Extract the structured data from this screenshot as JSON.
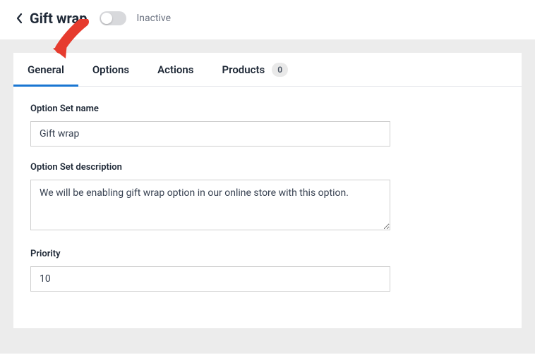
{
  "header": {
    "title": "Gift wrap",
    "status": "Inactive"
  },
  "tabs": {
    "general": "General",
    "options": "Options",
    "actions": "Actions",
    "products": "Products",
    "products_count": "0"
  },
  "form": {
    "name_label": "Option Set name",
    "name_value": "Gift wrap",
    "desc_label": "Option Set description",
    "desc_value": "We will be enabling gift wrap option in our online store with this option.",
    "priority_label": "Priority",
    "priority_value": "10"
  }
}
